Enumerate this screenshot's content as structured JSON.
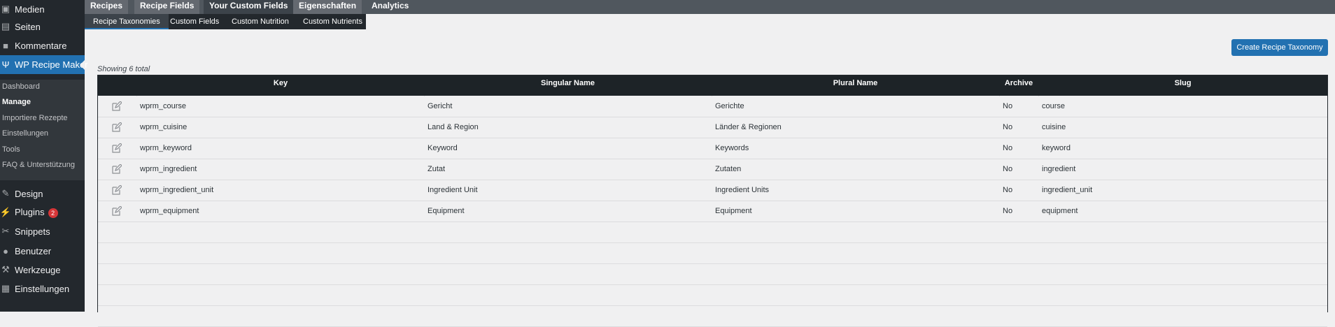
{
  "sidebar": {
    "items": [
      {
        "label": "Medien",
        "icon": "media-icon"
      },
      {
        "label": "Seiten",
        "icon": "pages-icon"
      },
      {
        "label": "Kommentare",
        "icon": "comments-icon"
      },
      {
        "label": "WP Recipe Maker",
        "icon": "fork-knife-icon"
      },
      {
        "label": "Design",
        "icon": "paintbrush-icon"
      },
      {
        "label": "Plugins",
        "icon": "plugin-icon",
        "badge": "2"
      },
      {
        "label": "Snippets",
        "icon": "scissors-icon"
      },
      {
        "label": "Benutzer",
        "icon": "user-icon"
      },
      {
        "label": "Werkzeuge",
        "icon": "wrench-icon"
      },
      {
        "label": "Einstellungen",
        "icon": "settings-icon"
      }
    ],
    "submenu": [
      "Dashboard",
      "Manage",
      "Importiere Rezepte",
      "Einstellungen",
      "Tools",
      "FAQ & Unterstützung"
    ]
  },
  "top_tabs": [
    "Recipes",
    "Recipe Fields",
    "Your Custom Fields",
    "Eigenschaften",
    "Analytics"
  ],
  "sub_tabs": [
    "Recipe Taxonomies",
    "Custom Fields",
    "Custom Nutrition",
    "Custom Nutrients"
  ],
  "create_button": "Create Recipe Taxonomy",
  "showing": "Showing 6 total",
  "table": {
    "headers": [
      "Key",
      "Singular Name",
      "Plural Name",
      "Archive",
      "Slug"
    ],
    "rows": [
      [
        "wprm_course",
        "Gericht",
        "Gerichte",
        "No",
        "course"
      ],
      [
        "wprm_cuisine",
        "Land & Region",
        "Länder & Regionen",
        "No",
        "cuisine"
      ],
      [
        "wprm_keyword",
        "Keyword",
        "Keywords",
        "No",
        "keyword"
      ],
      [
        "wprm_ingredient",
        "Zutat",
        "Zutaten",
        "No",
        "ingredient"
      ],
      [
        "wprm_ingredient_unit",
        "Ingredient Unit",
        "Ingredient Units",
        "No",
        "ingredient_unit"
      ],
      [
        "wprm_equipment",
        "Equipment",
        "Equipment",
        "No",
        "equipment"
      ]
    ]
  },
  "colors": {
    "accent": "#2271b1",
    "sidebar": "#23282d",
    "badge": "#d63638"
  }
}
